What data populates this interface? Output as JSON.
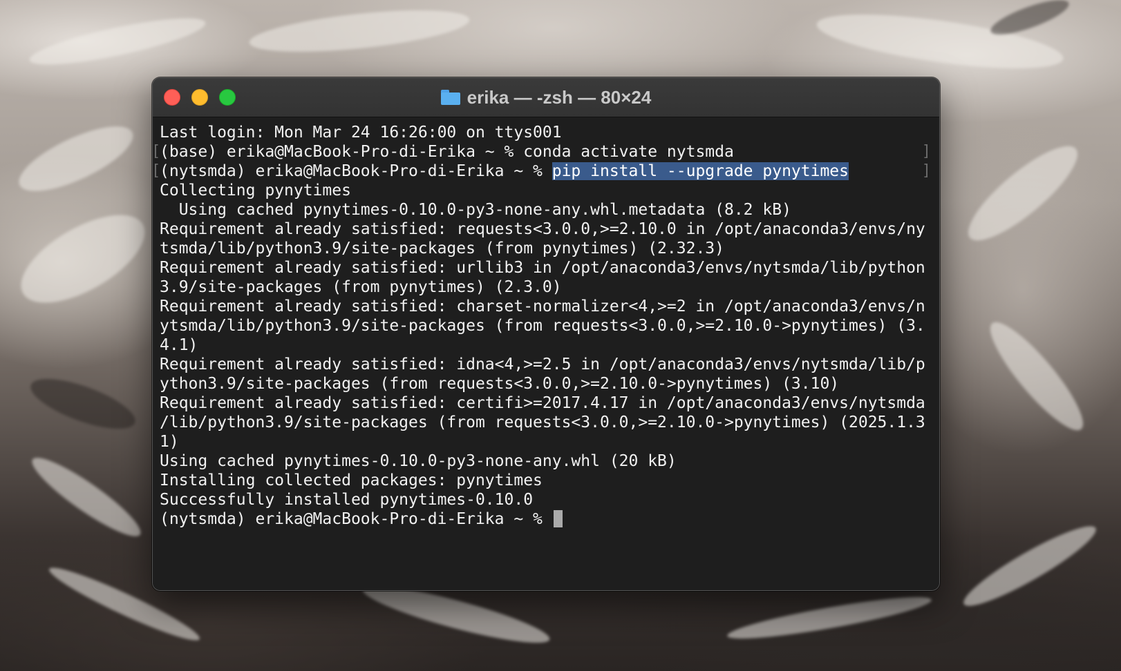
{
  "window": {
    "title": "erika — -zsh — 80×24",
    "folder_icon": "folder-icon",
    "traffic_lights": [
      "close",
      "minimize",
      "zoom"
    ]
  },
  "terminal": {
    "lines": [
      {
        "text": "Last login: Mon Mar 24 16:26:00 on ttys001"
      },
      {
        "text": "(base) erika@MacBook-Pro-di-Erika ~ % conda activate nytsmda",
        "brackets": true
      },
      {
        "prefix": "(nytsmda) erika@MacBook-Pro-di-Erika ~ % ",
        "selected": "pip install --upgrade pynytimes",
        "brackets": true
      },
      {
        "text": "Collecting pynytimes"
      },
      {
        "text": "  Using cached pynytimes-0.10.0-py3-none-any.whl.metadata (8.2 kB)"
      },
      {
        "text": "Requirement already satisfied: requests<3.0.0,>=2.10.0 in /opt/anaconda3/envs/ny"
      },
      {
        "text": "tsmda/lib/python3.9/site-packages (from pynytimes) (2.32.3)"
      },
      {
        "text": "Requirement already satisfied: urllib3 in /opt/anaconda3/envs/nytsmda/lib/python"
      },
      {
        "text": "3.9/site-packages (from pynytimes) (2.3.0)"
      },
      {
        "text": "Requirement already satisfied: charset-normalizer<4,>=2 in /opt/anaconda3/envs/n"
      },
      {
        "text": "ytsmda/lib/python3.9/site-packages (from requests<3.0.0,>=2.10.0->pynytimes) (3."
      },
      {
        "text": "4.1)"
      },
      {
        "text": "Requirement already satisfied: idna<4,>=2.5 in /opt/anaconda3/envs/nytsmda/lib/p"
      },
      {
        "text": "ython3.9/site-packages (from requests<3.0.0,>=2.10.0->pynytimes) (3.10)"
      },
      {
        "text": "Requirement already satisfied: certifi>=2017.4.17 in /opt/anaconda3/envs/nytsmda"
      },
      {
        "text": "/lib/python3.9/site-packages (from requests<3.0.0,>=2.10.0->pynytimes) (2025.1.3"
      },
      {
        "text": "1)"
      },
      {
        "text": "Using cached pynytimes-0.10.0-py3-none-any.whl (20 kB)"
      },
      {
        "text": "Installing collected packages: pynytimes"
      },
      {
        "text": "Successfully installed pynytimes-0.10.0"
      },
      {
        "prompt": "(nytsmda) erika@MacBook-Pro-di-Erika ~ % ",
        "cursor": true
      }
    ],
    "colors": {
      "background": "#1e1e1e",
      "foreground": "#f1f1f1",
      "selection": "#3a5b8c"
    }
  }
}
